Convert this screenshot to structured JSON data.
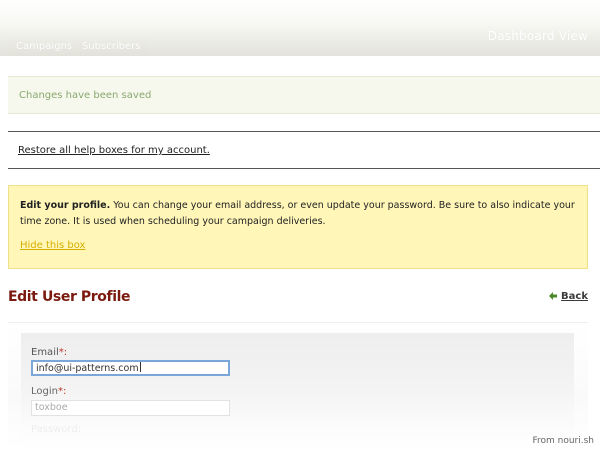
{
  "nav": {
    "tabs": [
      {
        "label": "Campaigns"
      },
      {
        "label": "Subscribers"
      }
    ],
    "dashboard_title": "Dashboard View"
  },
  "notice": {
    "saved_text": "Changes have been saved"
  },
  "restore": {
    "link_text": "Restore all help boxes for my account."
  },
  "help_box": {
    "bold_text": "Edit your profile.",
    "body_text": " You can change your email address, or even update your password. Be sure to also indicate your time zone. It is used when scheduling your campaign deliveries.",
    "hide_link": "Hide this box",
    "bg_color": "#fff6b8"
  },
  "page": {
    "title": "Edit User Profile",
    "back_label": "Back",
    "title_color": "#7a1a0e"
  },
  "form": {
    "email_label": "Email",
    "email_required": "*:",
    "email_value": "info@ui-patterns.com",
    "login_label": "Login",
    "login_required": "*:",
    "login_value": "toxboe",
    "third_label": "Password:"
  },
  "watermark": "From nouri.sh"
}
